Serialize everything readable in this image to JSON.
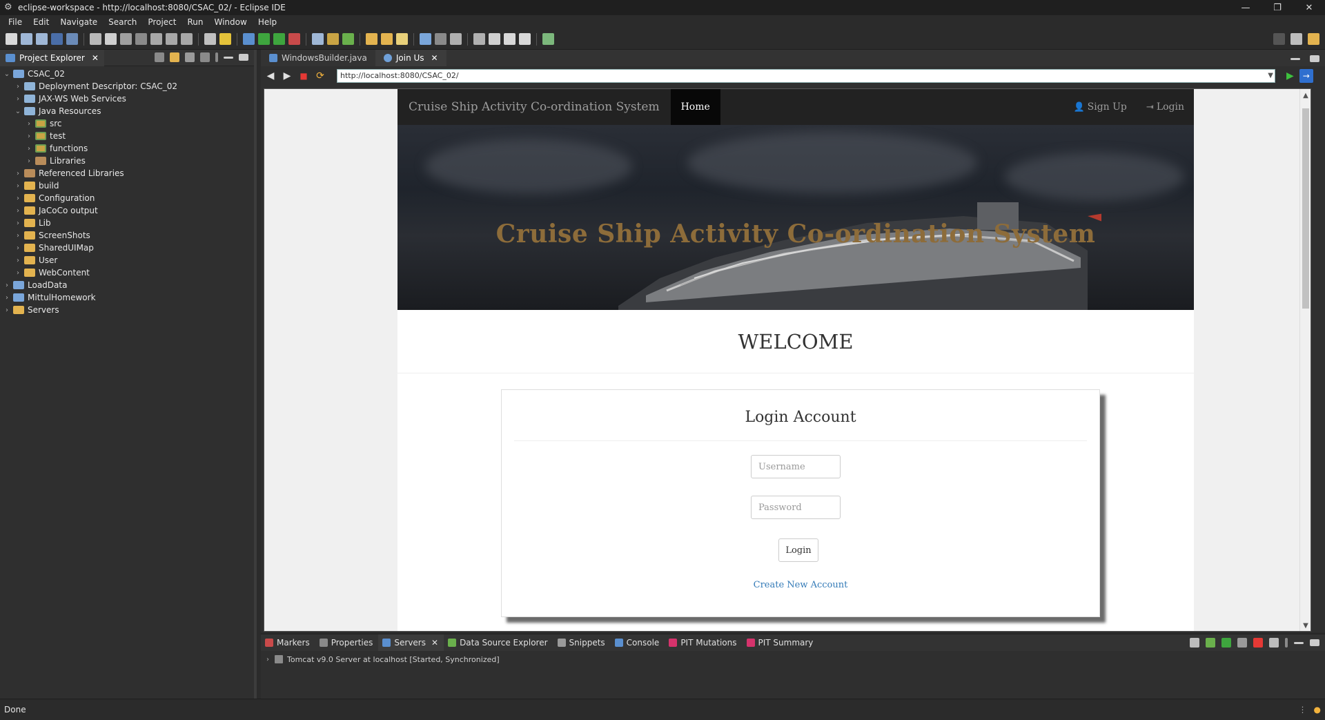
{
  "window": {
    "title": "eclipse-workspace - http://localhost:8080/CSAC_02/ - Eclipse IDE",
    "controls": [
      "—",
      "❐",
      "✕"
    ]
  },
  "menu": [
    "File",
    "Edit",
    "Navigate",
    "Search",
    "Project",
    "Run",
    "Window",
    "Help"
  ],
  "explorer": {
    "tab_label": "Project Explorer",
    "close": "✕",
    "tree": [
      {
        "label": "CSAC_02",
        "arrow": "⌄",
        "indent": 0,
        "icon": "project"
      },
      {
        "label": "Deployment Descriptor: CSAC_02",
        "arrow": "›",
        "indent": 1,
        "icon": "ws"
      },
      {
        "label": "JAX-WS Web Services",
        "arrow": "›",
        "indent": 1,
        "icon": "ws"
      },
      {
        "label": "Java Resources",
        "arrow": "⌄",
        "indent": 1,
        "icon": "ws"
      },
      {
        "label": "src",
        "arrow": "›",
        "indent": 2,
        "icon": "pkgfolder"
      },
      {
        "label": "test",
        "arrow": "›",
        "indent": 2,
        "icon": "pkgfolder"
      },
      {
        "label": "functions",
        "arrow": "›",
        "indent": 2,
        "icon": "pkgfolder"
      },
      {
        "label": "Libraries",
        "arrow": "›",
        "indent": 2,
        "icon": "lib"
      },
      {
        "label": "Referenced Libraries",
        "arrow": "›",
        "indent": 1,
        "icon": "lib"
      },
      {
        "label": "build",
        "arrow": "›",
        "indent": 1,
        "icon": "folder"
      },
      {
        "label": "Configuration",
        "arrow": "›",
        "indent": 1,
        "icon": "folder"
      },
      {
        "label": "JaCoCo output",
        "arrow": "›",
        "indent": 1,
        "icon": "folder"
      },
      {
        "label": "Lib",
        "arrow": "›",
        "indent": 1,
        "icon": "folder"
      },
      {
        "label": "ScreenShots",
        "arrow": "›",
        "indent": 1,
        "icon": "folder"
      },
      {
        "label": "SharedUIMap",
        "arrow": "›",
        "indent": 1,
        "icon": "folder"
      },
      {
        "label": "User",
        "arrow": "›",
        "indent": 1,
        "icon": "folder"
      },
      {
        "label": "WebContent",
        "arrow": "›",
        "indent": 1,
        "icon": "folder"
      },
      {
        "label": "LoadData",
        "arrow": "›",
        "indent": 0,
        "icon": "project"
      },
      {
        "label": "MittulHomework",
        "arrow": "›",
        "indent": 0,
        "icon": "project"
      },
      {
        "label": "Servers",
        "arrow": "›",
        "indent": 0,
        "icon": "folder"
      }
    ]
  },
  "editor": {
    "tabs": [
      {
        "label": "WindowsBuilder.java",
        "active": false
      },
      {
        "label": "Join Us",
        "active": true,
        "close": "✕"
      }
    ],
    "url": "http://localhost:8080/CSAC_02/"
  },
  "webpage": {
    "brand": "Cruise Ship Activity Co-ordination System",
    "nav_home": "Home",
    "nav_signup": "Sign Up",
    "nav_login": "Login",
    "hero_title": "Cruise Ship Activity Co-ordination System",
    "welcome": "WELCOME",
    "login_title": "Login Account",
    "username_placeholder": "Username",
    "password_placeholder": "Password",
    "login_button": "Login",
    "create_account": "Create New Account"
  },
  "bottom_panel": {
    "tabs": [
      {
        "label": "Markers",
        "icon_color": "#c94a4a"
      },
      {
        "label": "Properties",
        "icon_color": "#8a8a8a"
      },
      {
        "label": "Servers",
        "icon_color": "#5a8fcf",
        "active": true
      },
      {
        "label": "Data Source Explorer",
        "icon_color": "#6ab04c"
      },
      {
        "label": "Snippets",
        "icon_color": "#9a9a9a"
      },
      {
        "label": "Console",
        "icon_color": "#5a8fcf"
      },
      {
        "label": "PIT Mutations",
        "icon_color": "#d6336c"
      },
      {
        "label": "PIT Summary",
        "icon_color": "#d6336c"
      }
    ],
    "servers_close": "✕",
    "server_entry": "Tomcat v9.0 Server at localhost  [Started, Synchronized]"
  },
  "status": {
    "text": "Done"
  },
  "colors": {
    "ide_bg": "#2b2b2b",
    "navbar": "#222222",
    "hero_text": "#8d6c3a",
    "link": "#337ab7"
  }
}
